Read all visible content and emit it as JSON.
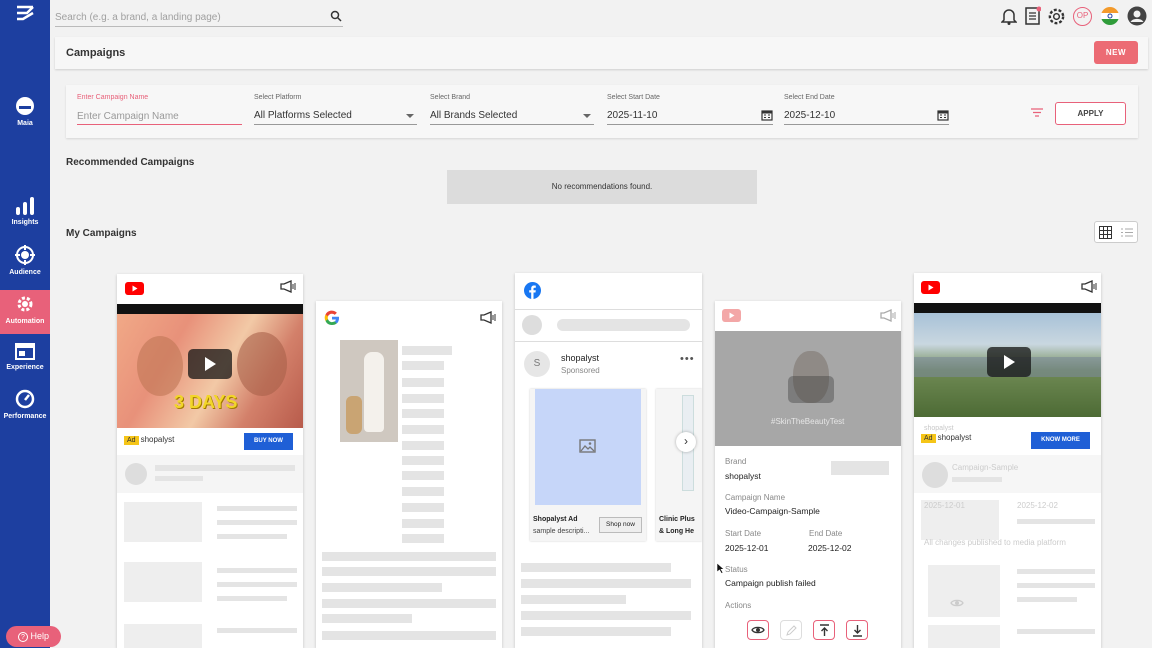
{
  "search": {
    "placeholder": "Search (e.g. a brand, a landing page)"
  },
  "sidebar": {
    "items": [
      {
        "label": "Maia",
        "icon": "maia-icon"
      },
      {
        "label": "Insights",
        "icon": "bar-chart-icon"
      },
      {
        "label": "Audience",
        "icon": "target-icon"
      },
      {
        "label": "Automation",
        "icon": "gear-icon"
      },
      {
        "label": "Experience",
        "icon": "browser-icon"
      },
      {
        "label": "Performance",
        "icon": "gauge-icon"
      }
    ]
  },
  "topbar": {
    "user_initials": "OP"
  },
  "header": {
    "title": "Campaigns",
    "new_label": "NEW"
  },
  "filters": {
    "campaign_name": {
      "label": "Enter Campaign Name",
      "placeholder": "Enter Campaign Name"
    },
    "platform": {
      "label": "Select Platform",
      "value": "All Platforms Selected"
    },
    "brand": {
      "label": "Select Brand",
      "value": "All Brands Selected"
    },
    "start_date": {
      "label": "Select Start Date",
      "value": "2025-11-10"
    },
    "end_date": {
      "label": "Select End Date",
      "value": "2025-12-10"
    },
    "apply_label": "APPLY"
  },
  "recommended": {
    "title": "Recommended Campaigns",
    "empty": "No recommendations found."
  },
  "my_campaigns": {
    "title": "My Campaigns"
  },
  "cards": {
    "c1": {
      "ad": "Ad",
      "brand": "shopalyst",
      "cta": "BUY NOW",
      "overlay": "3 DAYS"
    },
    "c3": {
      "brand": "shopalyst",
      "sponsored": "Sponsored",
      "product1_title": "Shopalyst Ad",
      "product1_desc": "sample descripti...",
      "product1_cta": "Shop now",
      "product2_line1": "Clinic Plus",
      "product2_line2": "& Long He"
    },
    "c4": {
      "overlay": "#SkinTheBeautyTest",
      "brand_label": "Brand",
      "brand": "shopalyst",
      "name_label": "Campaign Name",
      "name": "Video-Campaign-Sample",
      "start_label": "Start Date",
      "start": "2025-12-01",
      "end_label": "End Date",
      "end": "2025-12-02",
      "status_label": "Status",
      "status": "Campaign publish failed",
      "actions_label": "Actions"
    },
    "c5": {
      "ad": "Ad",
      "brand": "shopalyst",
      "cta": "KNOW MORE",
      "ghost_name": "Campaign-Sample",
      "ghost_start": "2025-12-01",
      "ghost_end": "2025-12-02",
      "ghost_status": "All changes published to media platform",
      "ghost_top": "shopalyst"
    }
  },
  "help": {
    "label": "Help"
  },
  "colors": {
    "sidebar": "#1d3fa0",
    "accent": "#e8617a",
    "cta": "#1f5fd6"
  }
}
